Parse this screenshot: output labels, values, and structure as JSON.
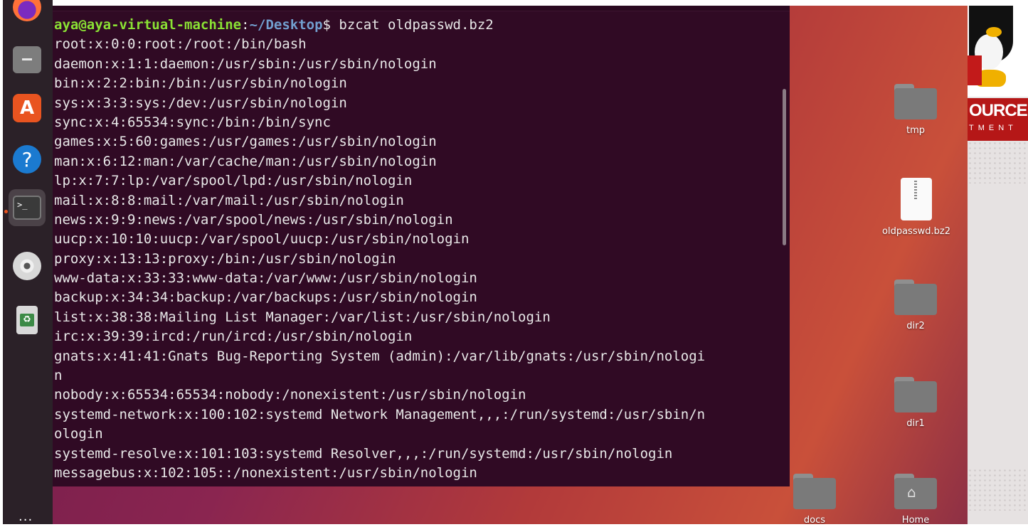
{
  "dock": {
    "items": [
      {
        "name": "firefox",
        "icon": "firefox-icon"
      },
      {
        "name": "files",
        "icon": "files-icon"
      },
      {
        "name": "app-center",
        "icon": "app-center-icon"
      },
      {
        "name": "help",
        "icon": "help-icon",
        "glyph": "?"
      },
      {
        "name": "terminal",
        "icon": "terminal-icon",
        "glyph": ">_",
        "active": true
      },
      {
        "name": "disc",
        "icon": "disc-icon"
      },
      {
        "name": "trash",
        "icon": "trash-icon"
      }
    ],
    "apps_glyph": "···"
  },
  "terminal": {
    "prompt_user": "aya@aya-virtual-machine",
    "prompt_sep": ":",
    "prompt_path": "~/Desktop",
    "prompt_end": "$ ",
    "command": "bzcat oldpasswd.bz2",
    "output_lines": [
      "root:x:0:0:root:/root:/bin/bash",
      "daemon:x:1:1:daemon:/usr/sbin:/usr/sbin/nologin",
      "bin:x:2:2:bin:/bin:/usr/sbin/nologin",
      "sys:x:3:3:sys:/dev:/usr/sbin/nologin",
      "sync:x:4:65534:sync:/bin:/bin/sync",
      "games:x:5:60:games:/usr/games:/usr/sbin/nologin",
      "man:x:6:12:man:/var/cache/man:/usr/sbin/nologin",
      "lp:x:7:7:lp:/var/spool/lpd:/usr/sbin/nologin",
      "mail:x:8:8:mail:/var/mail:/usr/sbin/nologin",
      "news:x:9:9:news:/var/spool/news:/usr/sbin/nologin",
      "uucp:x:10:10:uucp:/var/spool/uucp:/usr/sbin/nologin",
      "proxy:x:13:13:proxy:/bin:/usr/sbin/nologin",
      "www-data:x:33:33:www-data:/var/www:/usr/sbin/nologin",
      "backup:x:34:34:backup:/var/backups:/usr/sbin/nologin",
      "list:x:38:38:Mailing List Manager:/var/list:/usr/sbin/nologin",
      "irc:x:39:39:ircd:/run/ircd:/usr/sbin/nologin",
      "gnats:x:41:41:Gnats Bug-Reporting System (admin):/var/lib/gnats:/usr/sbin/nologi",
      "n",
      "nobody:x:65534:65534:nobody:/nonexistent:/usr/sbin/nologin",
      "systemd-network:x:100:102:systemd Network Management,,,:/run/systemd:/usr/sbin/n",
      "ologin",
      "systemd-resolve:x:101:103:systemd Resolver,,,:/run/systemd:/usr/sbin/nologin",
      "messagebus:x:102:105::/nonexistent:/usr/sbin/nologin"
    ]
  },
  "desktop": {
    "icons": [
      {
        "label": "tmp",
        "type": "folder"
      },
      {
        "label": "oldpasswd.bz2",
        "type": "archive"
      },
      {
        "label": "dir2",
        "type": "folder"
      },
      {
        "label": "dir1",
        "type": "folder"
      },
      {
        "label": "docs",
        "type": "folder"
      },
      {
        "label": "Home",
        "type": "home-folder"
      }
    ]
  },
  "side_image": {
    "word": "OURCE",
    "sub": "TMENT"
  },
  "colors": {
    "terminal_bg": "#300a24",
    "prompt_user": "#8ae234",
    "prompt_path": "#729fcf",
    "accent": "#e95420"
  }
}
